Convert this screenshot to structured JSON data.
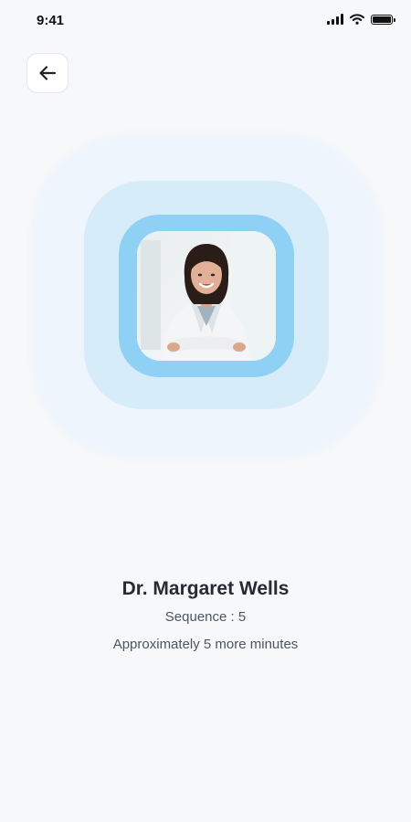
{
  "status_bar": {
    "time": "9:41",
    "icons": [
      "signal-icon",
      "wifi-icon",
      "battery-icon"
    ]
  },
  "header": {
    "back_icon": "arrow-left-icon"
  },
  "doctor": {
    "name": "Dr. Margaret Wells",
    "sequence": "Sequence : 5",
    "wait_time": "Approximately 5 more minutes"
  },
  "colors": {
    "background": "#f7f8fa",
    "ring_outer": "#eef5fc",
    "ring_mid": "#d6ecf9",
    "ring_inner": "#8fd1f4",
    "text_primary": "#262a33",
    "text_secondary": "#4b5563"
  }
}
